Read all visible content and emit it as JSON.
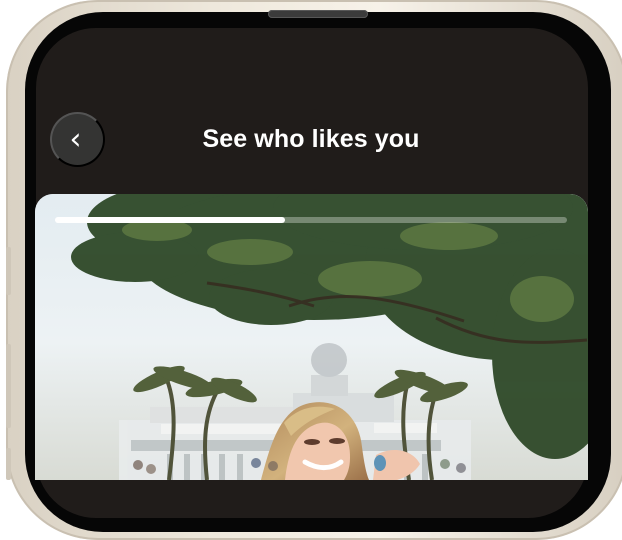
{
  "header": {
    "title": "See who likes you",
    "back_icon": "chevron-left-icon"
  },
  "profile_story": {
    "progress": 0.45
  },
  "colors": {
    "screen_background": "#201c1a",
    "back_button_background": "#343433",
    "title_text": "#ffffff",
    "progress_fill": "#ffffff"
  }
}
